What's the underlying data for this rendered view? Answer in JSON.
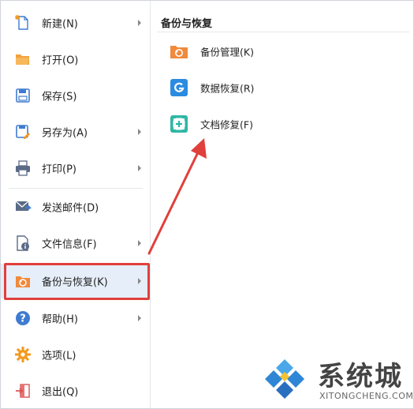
{
  "menu": {
    "items": [
      {
        "label": "新建(N)",
        "icon": "new-file-icon",
        "has_submenu": true
      },
      {
        "label": "打开(O)",
        "icon": "open-folder-icon",
        "has_submenu": false
      },
      {
        "label": "保存(S)",
        "icon": "save-icon",
        "has_submenu": false
      },
      {
        "label": "另存为(A)",
        "icon": "save-as-icon",
        "has_submenu": true
      },
      {
        "label": "打印(P)",
        "icon": "printer-icon",
        "has_submenu": true
      },
      {
        "label": "发送邮件(D)",
        "icon": "send-mail-icon",
        "has_submenu": false
      },
      {
        "label": "文件信息(F)",
        "icon": "file-info-icon",
        "has_submenu": true
      },
      {
        "label": "备份与恢复(K)",
        "icon": "backup-restore-icon",
        "has_submenu": true,
        "selected": true
      },
      {
        "label": "帮助(H)",
        "icon": "help-icon",
        "has_submenu": true
      },
      {
        "label": "选项(L)",
        "icon": "options-gear-icon",
        "has_submenu": false
      },
      {
        "label": "退出(Q)",
        "icon": "exit-icon",
        "has_submenu": false
      }
    ]
  },
  "submenu": {
    "title": "备份与恢复",
    "items": [
      {
        "label": "备份管理(K)",
        "icon": "backup-manage-icon"
      },
      {
        "label": "数据恢复(R)",
        "icon": "data-recovery-icon"
      },
      {
        "label": "文档修复(F)",
        "icon": "doc-repair-icon"
      }
    ]
  },
  "watermark": {
    "brand": "系统城",
    "domain": "XITONGCHENG.COM"
  },
  "colors": {
    "highlight": "#e0403c",
    "selected_bg": "#e6eef9",
    "accent_orange": "#f08a3c",
    "accent_blue": "#2a8be0",
    "accent_teal": "#2fb7a4"
  }
}
